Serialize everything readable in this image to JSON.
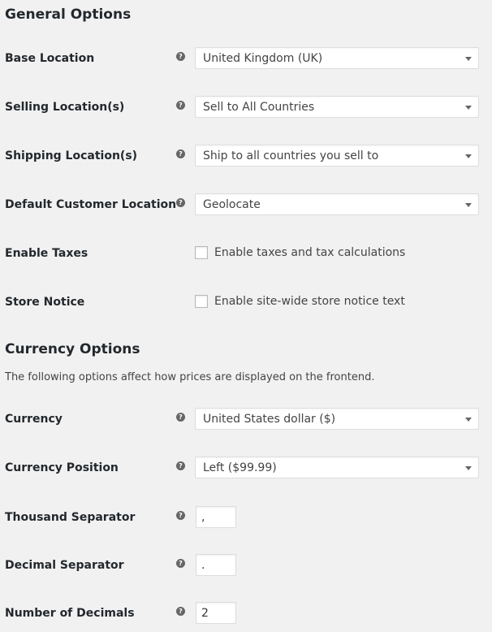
{
  "general": {
    "heading": "General Options",
    "rows": [
      {
        "label": "Base Location",
        "value": "United Kingdom (UK)"
      },
      {
        "label": "Selling Location(s)",
        "value": "Sell to All Countries"
      },
      {
        "label": "Shipping Location(s)",
        "value": "Ship to all countries you sell to"
      },
      {
        "label": "Default Customer Location",
        "value": "Geolocate"
      }
    ],
    "taxes": {
      "label": "Enable Taxes",
      "checkbox_label": "Enable taxes and tax calculations",
      "checked": false
    },
    "notice": {
      "label": "Store Notice",
      "checkbox_label": "Enable site-wide store notice text",
      "checked": false
    }
  },
  "currency": {
    "heading": "Currency Options",
    "description": "The following options affect how prices are displayed on the frontend.",
    "currency": {
      "label": "Currency",
      "value": "United States dollar ($)"
    },
    "position": {
      "label": "Currency Position",
      "value": "Left ($99.99)"
    },
    "thousand": {
      "label": "Thousand Separator",
      "value": ","
    },
    "decimal": {
      "label": "Decimal Separator",
      "value": "."
    },
    "decimals": {
      "label": "Number of Decimals",
      "value": "2"
    }
  },
  "help_icon_glyph": "?"
}
